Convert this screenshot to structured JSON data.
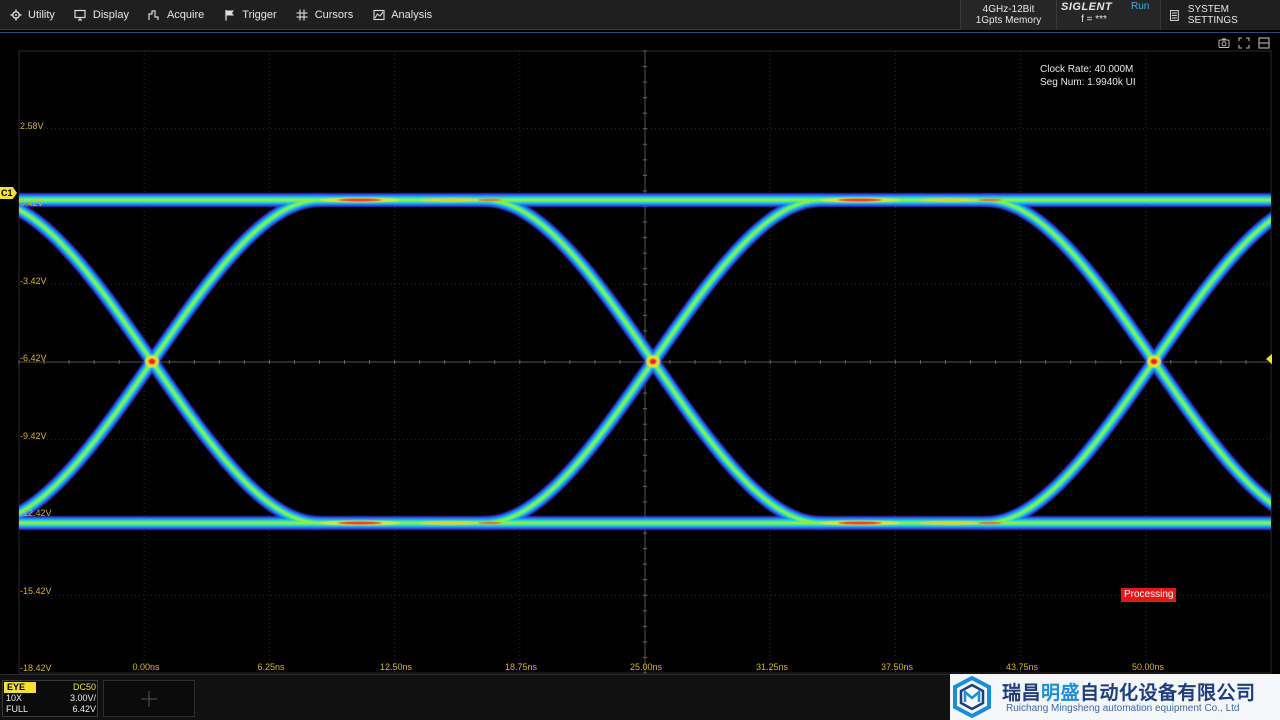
{
  "menu": {
    "items": [
      {
        "label": "Utility",
        "icon": "gear-icon"
      },
      {
        "label": "Display",
        "icon": "monitor-icon"
      },
      {
        "label": "Acquire",
        "icon": "acquire-icon"
      },
      {
        "label": "Trigger",
        "icon": "flag-icon"
      },
      {
        "label": "Cursors",
        "icon": "cursors-icon"
      },
      {
        "label": "Analysis",
        "icon": "analysis-icon"
      }
    ]
  },
  "status": {
    "bandwidth": "4GHz-12Bit",
    "memory": "1Gpts Memory",
    "brand": "SIGLENT",
    "run_state": "Run",
    "frequency": "f = ***",
    "system_settings": "SYSTEM SETTINGS"
  },
  "measurements": {
    "clock_rate": "Clock Rate: 40.000M",
    "seg_num": "Seg Num: 1.9940k UI"
  },
  "axes": {
    "voltage_labels": [
      "2.58V",
      "0.42V",
      "-3.42V",
      "-6.42V",
      "-9.42V",
      "-12.42V",
      "-15.42V",
      "-18.42V"
    ],
    "time_labels": [
      "0.00ns",
      "6.25ns",
      "12.50ns",
      "18.75ns",
      "25.00ns",
      "31.25ns",
      "37.50ns",
      "43.75ns",
      "50.00ns"
    ]
  },
  "channel": {
    "marker": "C1",
    "mode": "EYE",
    "coupling": "DC50",
    "probe": "10X",
    "scale": "3.00V/",
    "bandwidth_limit": "FULL",
    "offset": "6.42V",
    "color": "#f5e03a"
  },
  "processing_label": "Processing",
  "watermark": {
    "cn_part1": "瑞昌",
    "cn_highlight": "明盛",
    "cn_part2": "自动化设备有限公司",
    "en": "Ruichang Mingsheng automation equipment Co., Ltd"
  }
}
